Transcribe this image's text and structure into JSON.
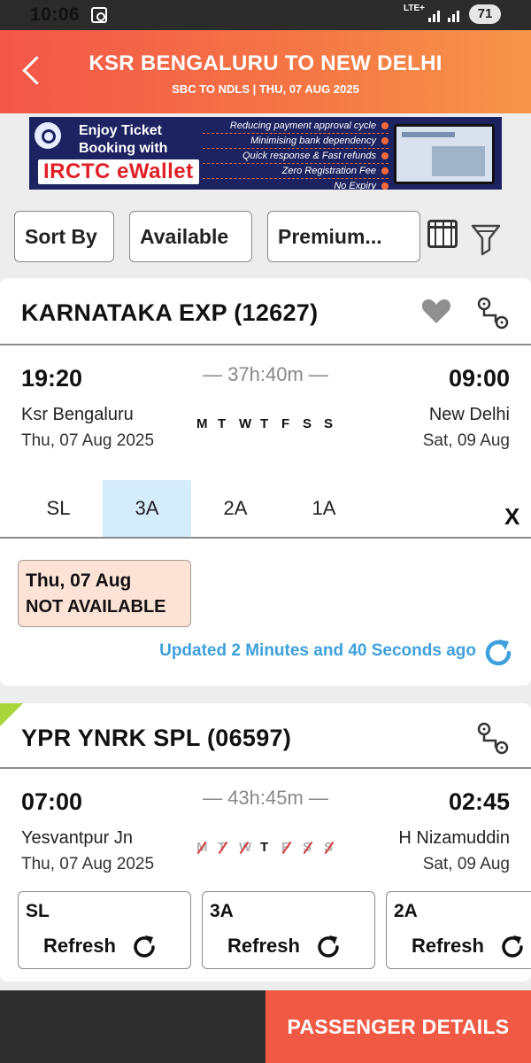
{
  "status_bar": {
    "time": "10:06",
    "network": "LTE+",
    "battery": "71"
  },
  "header": {
    "title": "KSR BENGALURU TO NEW DELHI",
    "subtitle": "SBC TO NDLS | THU, 07 AUG  2025"
  },
  "banner": {
    "headline_line1": "Enjoy Ticket",
    "headline_line2": "Booking with",
    "brand": "IRCTC eWallet",
    "features": [
      "Reducing payment approval cycle",
      "Minimising bank dependency",
      "Quick response & Fast refunds",
      "Zero Registration Fee",
      "No Expiry"
    ]
  },
  "filters": {
    "sort_label": "Sort By",
    "available_label": "Available",
    "premium_label": "Premium..."
  },
  "trains": [
    {
      "name": "KARNATAKA EXP (12627)",
      "depart_time": "19:20",
      "arrive_time": "09:00",
      "duration": "37h:40m",
      "from_station": "Ksr Bengaluru",
      "to_station": "New Delhi",
      "depart_date": "Thu, 07 Aug  2025",
      "arrive_date": "Sat, 09 Aug",
      "days": [
        "M",
        "T",
        "W",
        "T",
        "F",
        "S",
        "S"
      ],
      "classes": [
        "SL",
        "3A",
        "2A",
        "1A"
      ],
      "selected_class": "3A",
      "close_label": "X",
      "availability": {
        "date": "Thu, 07 Aug",
        "status": "NOT AVAILABLE"
      },
      "updated_text": "Updated 2 Minutes and 40 Seconds ago"
    },
    {
      "name": "YPR YNRK SPL (06597)",
      "depart_time": "07:00",
      "arrive_time": "02:45",
      "duration": "43h:45m",
      "from_station": "Yesvantpur Jn",
      "to_station": "H Nizamuddin",
      "depart_date": "Thu, 07 Aug  2025",
      "arrive_date": "Sat, 09 Aug",
      "days": [
        "M",
        "T",
        "W",
        "T",
        "F",
        "S",
        "S"
      ],
      "running_days": [
        false,
        false,
        false,
        true,
        false,
        false,
        false
      ],
      "class_cards": [
        {
          "cls": "SL",
          "action": "Refresh"
        },
        {
          "cls": "3A",
          "action": "Refresh"
        },
        {
          "cls": "2A",
          "action": "Refresh"
        }
      ]
    }
  ],
  "footer": {
    "cta_label": "PASSENGER DETAILS"
  },
  "colors": {
    "header_start": "#f3564a",
    "header_end": "#f7954a",
    "selected_class_bg": "#d4ecfb",
    "not_available_bg": "#fde3d6",
    "updated_text": "#3ea0dc",
    "cta": "#f05a45"
  }
}
